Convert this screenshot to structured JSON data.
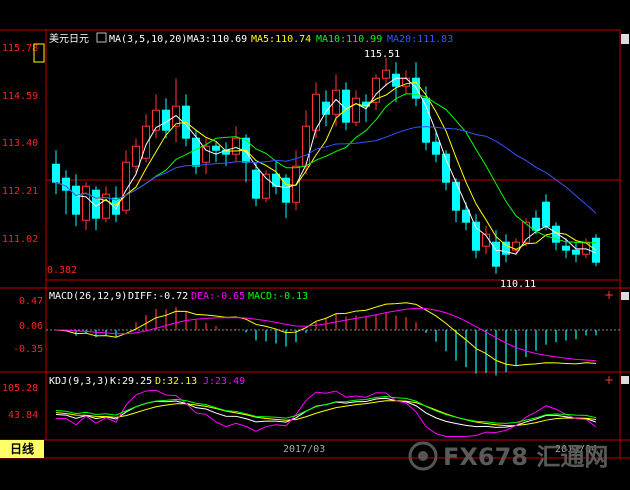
{
  "symbol": "美元日元",
  "main": {
    "indicator": "MA(3,5,10,20)",
    "ma3": "MA3:110.69",
    "ma5": "MA5:110.74",
    "ma10": "MA10:110.99",
    "ma20": "MA20:111.83",
    "price_axis": [
      "115.78",
      "114.59",
      "113.40",
      "112.21",
      "111.02"
    ],
    "high_label": "115.51",
    "low_label": "110.11",
    "corner_value": "0.382",
    "candles": [
      [
        112.85,
        112.4,
        113.2,
        112.1
      ],
      [
        112.5,
        112.2,
        112.7,
        111.6
      ],
      [
        112.3,
        111.6,
        112.6,
        111.3
      ],
      [
        111.45,
        112.3,
        112.4,
        111.2
      ],
      [
        112.2,
        111.5,
        112.3,
        111.2
      ],
      [
        111.5,
        112.1,
        112.3,
        111.4
      ],
      [
        112.0,
        111.6,
        112.3,
        111.4
      ],
      [
        111.7,
        112.9,
        113.2,
        111.6
      ],
      [
        112.8,
        113.3,
        113.5,
        112.6
      ],
      [
        113.0,
        113.8,
        114.1,
        112.9
      ],
      [
        113.7,
        114.2,
        114.6,
        113.5
      ],
      [
        114.2,
        113.7,
        114.5,
        113.5
      ],
      [
        113.8,
        114.3,
        115.0,
        113.4
      ],
      [
        114.3,
        113.5,
        114.6,
        113.3
      ],
      [
        113.5,
        112.8,
        113.7,
        112.6
      ],
      [
        112.9,
        113.3,
        113.5,
        112.6
      ],
      [
        113.3,
        113.2,
        113.4,
        112.9
      ],
      [
        113.2,
        113.1,
        113.4,
        112.8
      ],
      [
        113.1,
        113.5,
        113.8,
        112.9
      ],
      [
        113.5,
        112.9,
        113.6,
        112.4
      ],
      [
        112.7,
        112.0,
        112.9,
        111.8
      ],
      [
        112.0,
        112.6,
        112.7,
        111.9
      ],
      [
        112.6,
        112.3,
        112.9,
        112.1
      ],
      [
        112.5,
        111.9,
        112.6,
        111.5
      ],
      [
        111.9,
        112.8,
        113.2,
        111.7
      ],
      [
        112.8,
        113.8,
        114.2,
        112.6
      ],
      [
        113.7,
        114.6,
        114.9,
        113.5
      ],
      [
        114.4,
        114.1,
        114.7,
        113.8
      ],
      [
        114.1,
        114.7,
        115.1,
        113.8
      ],
      [
        114.7,
        113.9,
        114.9,
        113.7
      ],
      [
        113.9,
        114.5,
        114.7,
        113.8
      ],
      [
        114.4,
        114.3,
        114.6,
        113.9
      ],
      [
        114.4,
        115.0,
        115.1,
        114.2
      ],
      [
        115.0,
        115.2,
        115.51,
        114.8
      ],
      [
        115.1,
        114.8,
        115.4,
        114.4
      ],
      [
        114.8,
        115.0,
        115.2,
        114.6
      ],
      [
        115.0,
        114.5,
        115.4,
        114.3
      ],
      [
        114.5,
        113.4,
        114.8,
        113.2
      ],
      [
        113.4,
        113.1,
        113.7,
        112.9
      ],
      [
        113.1,
        112.4,
        113.2,
        112.2
      ],
      [
        112.4,
        111.7,
        112.5,
        111.4
      ],
      [
        111.7,
        111.4,
        111.9,
        111.2
      ],
      [
        111.4,
        110.7,
        111.6,
        110.5
      ],
      [
        110.8,
        111.1,
        111.3,
        110.6
      ],
      [
        110.9,
        110.3,
        111.2,
        110.11
      ],
      [
        110.9,
        110.6,
        111.1,
        110.4
      ],
      [
        110.7,
        110.9,
        111.0,
        110.6
      ],
      [
        110.9,
        111.4,
        111.5,
        110.8
      ],
      [
        111.5,
        111.2,
        111.7,
        111.1
      ],
      [
        111.9,
        111.3,
        112.1,
        111.2
      ],
      [
        111.3,
        110.9,
        111.4,
        110.7
      ],
      [
        110.8,
        110.7,
        111.0,
        110.5
      ],
      [
        110.7,
        110.6,
        110.9,
        110.4
      ],
      [
        110.6,
        110.9,
        111.0,
        110.5
      ],
      [
        111.0,
        110.4,
        111.1,
        110.3
      ]
    ]
  },
  "macd": {
    "indicator": "MACD(26,12,9)",
    "diff": "DIFF:-0.72",
    "dea": "DEA:-0.65",
    "macd": "MACD:-0.13",
    "axis": [
      "0.47",
      "0.06",
      "-0.35"
    ]
  },
  "kdj": {
    "indicator": "KDJ(9,3,3)",
    "k": "K:29.25",
    "d": "D:32.13",
    "j": "J:23.49",
    "axis": [
      "105.28",
      "43.84"
    ]
  },
  "time_axis": [
    "2017/03",
    "2017/04"
  ],
  "period_tab": "日线",
  "watermark": "FX678 汇通网",
  "colors": {
    "up": "#ff3333",
    "down": "#00ffff",
    "ma3": "#ffffff",
    "ma5": "#ffff00",
    "ma10": "#00ff00",
    "ma20": "#3355ff",
    "dea": "#ff00ff",
    "axis": "#ff2020"
  }
}
